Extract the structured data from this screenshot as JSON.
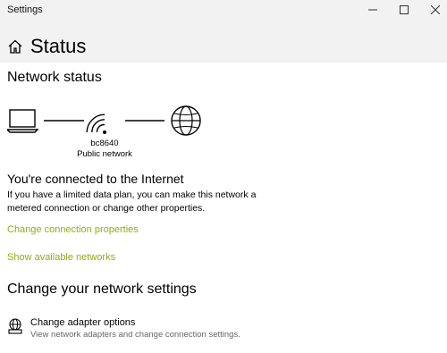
{
  "window": {
    "title": "Settings"
  },
  "header": {
    "title": "Status"
  },
  "network_status": {
    "heading": "Network status",
    "network_name": "bc8640",
    "network_type": "Public network",
    "connected_title": "You're connected to the Internet",
    "connected_body": "If you have a limited data plan, you can make this network a metered connection or change other properties.",
    "links": {
      "change_connection_properties": "Change connection properties",
      "show_available_networks": "Show available networks"
    }
  },
  "change_settings": {
    "heading": "Change your network settings",
    "items": [
      {
        "title": "Change adapter options",
        "description": "View network adapters and change connection settings.",
        "icon": "network-adapter-icon"
      }
    ]
  },
  "colors": {
    "link": "#8fae12",
    "titlebar_bg": "#f2f2f2"
  }
}
